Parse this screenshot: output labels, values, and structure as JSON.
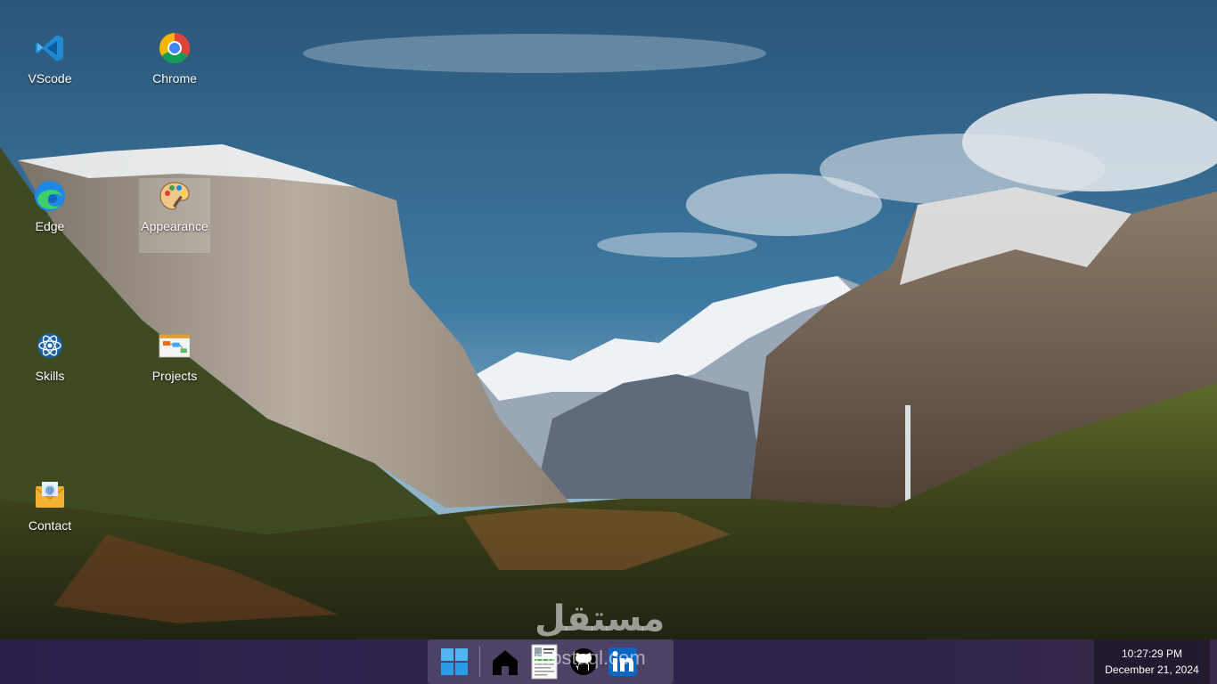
{
  "desktop": {
    "icons": [
      {
        "label": "VScode",
        "icon": "vscode-icon"
      },
      {
        "label": "Chrome",
        "icon": "chrome-icon"
      },
      {
        "label": "Edge",
        "icon": "edge-icon"
      },
      {
        "label": "Appearance",
        "icon": "palette-icon",
        "selected": true
      },
      {
        "label": "Skills",
        "icon": "react-icon"
      },
      {
        "label": "Projects",
        "icon": "projects-board-icon"
      },
      {
        "label": "Contact",
        "icon": "mail-envelope-icon"
      }
    ]
  },
  "taskbar": {
    "dock": [
      {
        "icon": "windows-start-icon"
      },
      {
        "icon": "home-icon"
      },
      {
        "icon": "resume-document-icon"
      },
      {
        "icon": "github-icon"
      },
      {
        "icon": "linkedin-icon"
      }
    ],
    "clock": {
      "time": "10:27:29 PM",
      "date": "December 21, 2024"
    }
  },
  "watermark": {
    "arabic": "مستقل",
    "latin": "mostaql.com"
  },
  "colors": {
    "taskbar": "#2a1f4a",
    "sky": "#2f5f86",
    "forest": "#2f3a1c",
    "accent_blue": "#0a66c2"
  }
}
